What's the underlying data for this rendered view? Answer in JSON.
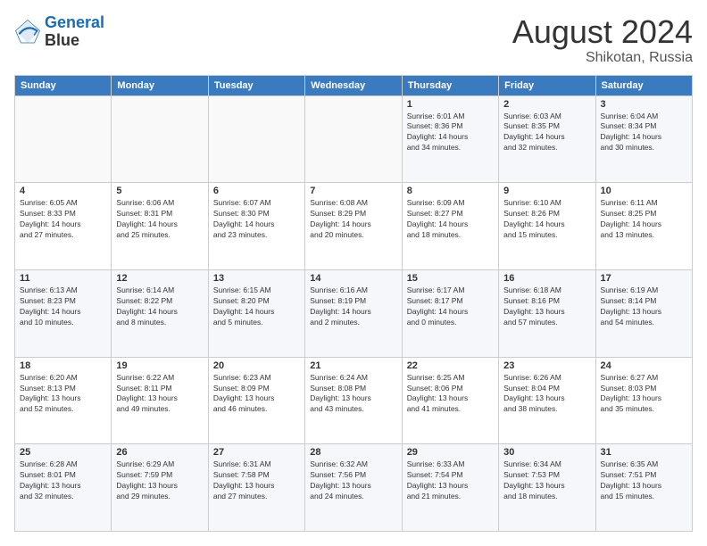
{
  "logo": {
    "line1": "General",
    "line2": "Blue"
  },
  "title": "August 2024",
  "subtitle": "Shikotan, Russia",
  "header_days": [
    "Sunday",
    "Monday",
    "Tuesday",
    "Wednesday",
    "Thursday",
    "Friday",
    "Saturday"
  ],
  "weeks": [
    [
      {
        "day": "",
        "info": ""
      },
      {
        "day": "",
        "info": ""
      },
      {
        "day": "",
        "info": ""
      },
      {
        "day": "",
        "info": ""
      },
      {
        "day": "1",
        "info": "Sunrise: 6:01 AM\nSunset: 8:36 PM\nDaylight: 14 hours\nand 34 minutes."
      },
      {
        "day": "2",
        "info": "Sunrise: 6:03 AM\nSunset: 8:35 PM\nDaylight: 14 hours\nand 32 minutes."
      },
      {
        "day": "3",
        "info": "Sunrise: 6:04 AM\nSunset: 8:34 PM\nDaylight: 14 hours\nand 30 minutes."
      }
    ],
    [
      {
        "day": "4",
        "info": "Sunrise: 6:05 AM\nSunset: 8:33 PM\nDaylight: 14 hours\nand 27 minutes."
      },
      {
        "day": "5",
        "info": "Sunrise: 6:06 AM\nSunset: 8:31 PM\nDaylight: 14 hours\nand 25 minutes."
      },
      {
        "day": "6",
        "info": "Sunrise: 6:07 AM\nSunset: 8:30 PM\nDaylight: 14 hours\nand 23 minutes."
      },
      {
        "day": "7",
        "info": "Sunrise: 6:08 AM\nSunset: 8:29 PM\nDaylight: 14 hours\nand 20 minutes."
      },
      {
        "day": "8",
        "info": "Sunrise: 6:09 AM\nSunset: 8:27 PM\nDaylight: 14 hours\nand 18 minutes."
      },
      {
        "day": "9",
        "info": "Sunrise: 6:10 AM\nSunset: 8:26 PM\nDaylight: 14 hours\nand 15 minutes."
      },
      {
        "day": "10",
        "info": "Sunrise: 6:11 AM\nSunset: 8:25 PM\nDaylight: 14 hours\nand 13 minutes."
      }
    ],
    [
      {
        "day": "11",
        "info": "Sunrise: 6:13 AM\nSunset: 8:23 PM\nDaylight: 14 hours\nand 10 minutes."
      },
      {
        "day": "12",
        "info": "Sunrise: 6:14 AM\nSunset: 8:22 PM\nDaylight: 14 hours\nand 8 minutes."
      },
      {
        "day": "13",
        "info": "Sunrise: 6:15 AM\nSunset: 8:20 PM\nDaylight: 14 hours\nand 5 minutes."
      },
      {
        "day": "14",
        "info": "Sunrise: 6:16 AM\nSunset: 8:19 PM\nDaylight: 14 hours\nand 2 minutes."
      },
      {
        "day": "15",
        "info": "Sunrise: 6:17 AM\nSunset: 8:17 PM\nDaylight: 14 hours\nand 0 minutes."
      },
      {
        "day": "16",
        "info": "Sunrise: 6:18 AM\nSunset: 8:16 PM\nDaylight: 13 hours\nand 57 minutes."
      },
      {
        "day": "17",
        "info": "Sunrise: 6:19 AM\nSunset: 8:14 PM\nDaylight: 13 hours\nand 54 minutes."
      }
    ],
    [
      {
        "day": "18",
        "info": "Sunrise: 6:20 AM\nSunset: 8:13 PM\nDaylight: 13 hours\nand 52 minutes."
      },
      {
        "day": "19",
        "info": "Sunrise: 6:22 AM\nSunset: 8:11 PM\nDaylight: 13 hours\nand 49 minutes."
      },
      {
        "day": "20",
        "info": "Sunrise: 6:23 AM\nSunset: 8:09 PM\nDaylight: 13 hours\nand 46 minutes."
      },
      {
        "day": "21",
        "info": "Sunrise: 6:24 AM\nSunset: 8:08 PM\nDaylight: 13 hours\nand 43 minutes."
      },
      {
        "day": "22",
        "info": "Sunrise: 6:25 AM\nSunset: 8:06 PM\nDaylight: 13 hours\nand 41 minutes."
      },
      {
        "day": "23",
        "info": "Sunrise: 6:26 AM\nSunset: 8:04 PM\nDaylight: 13 hours\nand 38 minutes."
      },
      {
        "day": "24",
        "info": "Sunrise: 6:27 AM\nSunset: 8:03 PM\nDaylight: 13 hours\nand 35 minutes."
      }
    ],
    [
      {
        "day": "25",
        "info": "Sunrise: 6:28 AM\nSunset: 8:01 PM\nDaylight: 13 hours\nand 32 minutes."
      },
      {
        "day": "26",
        "info": "Sunrise: 6:29 AM\nSunset: 7:59 PM\nDaylight: 13 hours\nand 29 minutes."
      },
      {
        "day": "27",
        "info": "Sunrise: 6:31 AM\nSunset: 7:58 PM\nDaylight: 13 hours\nand 27 minutes."
      },
      {
        "day": "28",
        "info": "Sunrise: 6:32 AM\nSunset: 7:56 PM\nDaylight: 13 hours\nand 24 minutes."
      },
      {
        "day": "29",
        "info": "Sunrise: 6:33 AM\nSunset: 7:54 PM\nDaylight: 13 hours\nand 21 minutes."
      },
      {
        "day": "30",
        "info": "Sunrise: 6:34 AM\nSunset: 7:53 PM\nDaylight: 13 hours\nand 18 minutes."
      },
      {
        "day": "31",
        "info": "Sunrise: 6:35 AM\nSunset: 7:51 PM\nDaylight: 13 hours\nand 15 minutes."
      }
    ]
  ]
}
